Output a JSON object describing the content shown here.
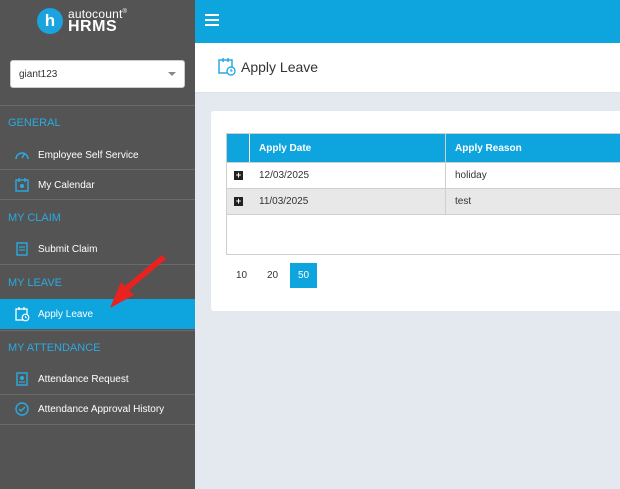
{
  "brand": {
    "small": "autocount",
    "reg": "®",
    "big": "HRMS",
    "logo_letter": "h"
  },
  "company_select": {
    "value": "giant123"
  },
  "sections": {
    "general": "GENERAL",
    "claim": "MY CLAIM",
    "leave": "MY LEAVE",
    "attendance": "MY ATTENDANCE"
  },
  "nav": {
    "employee_self_service": "Employee Self Service",
    "my_calendar": "My Calendar",
    "submit_claim": "Submit Claim",
    "apply_leave": "Apply Leave",
    "attendance_request": "Attendance Request",
    "attendance_approval_history": "Attendance Approval History"
  },
  "page": {
    "title": "Apply Leave"
  },
  "table": {
    "headers": {
      "date": "Apply Date",
      "reason": "Apply Reason"
    },
    "rows": [
      {
        "date": "12/03/2025",
        "reason": "holiday"
      },
      {
        "date": "11/03/2025",
        "reason": "test"
      }
    ]
  },
  "pager": {
    "sizes": [
      "10",
      "20",
      "50"
    ],
    "selected": "50"
  },
  "colors": {
    "accent": "#0ea5df",
    "sidebar": "#545454",
    "section": "#29abe2",
    "annotation": "#e8231f"
  }
}
